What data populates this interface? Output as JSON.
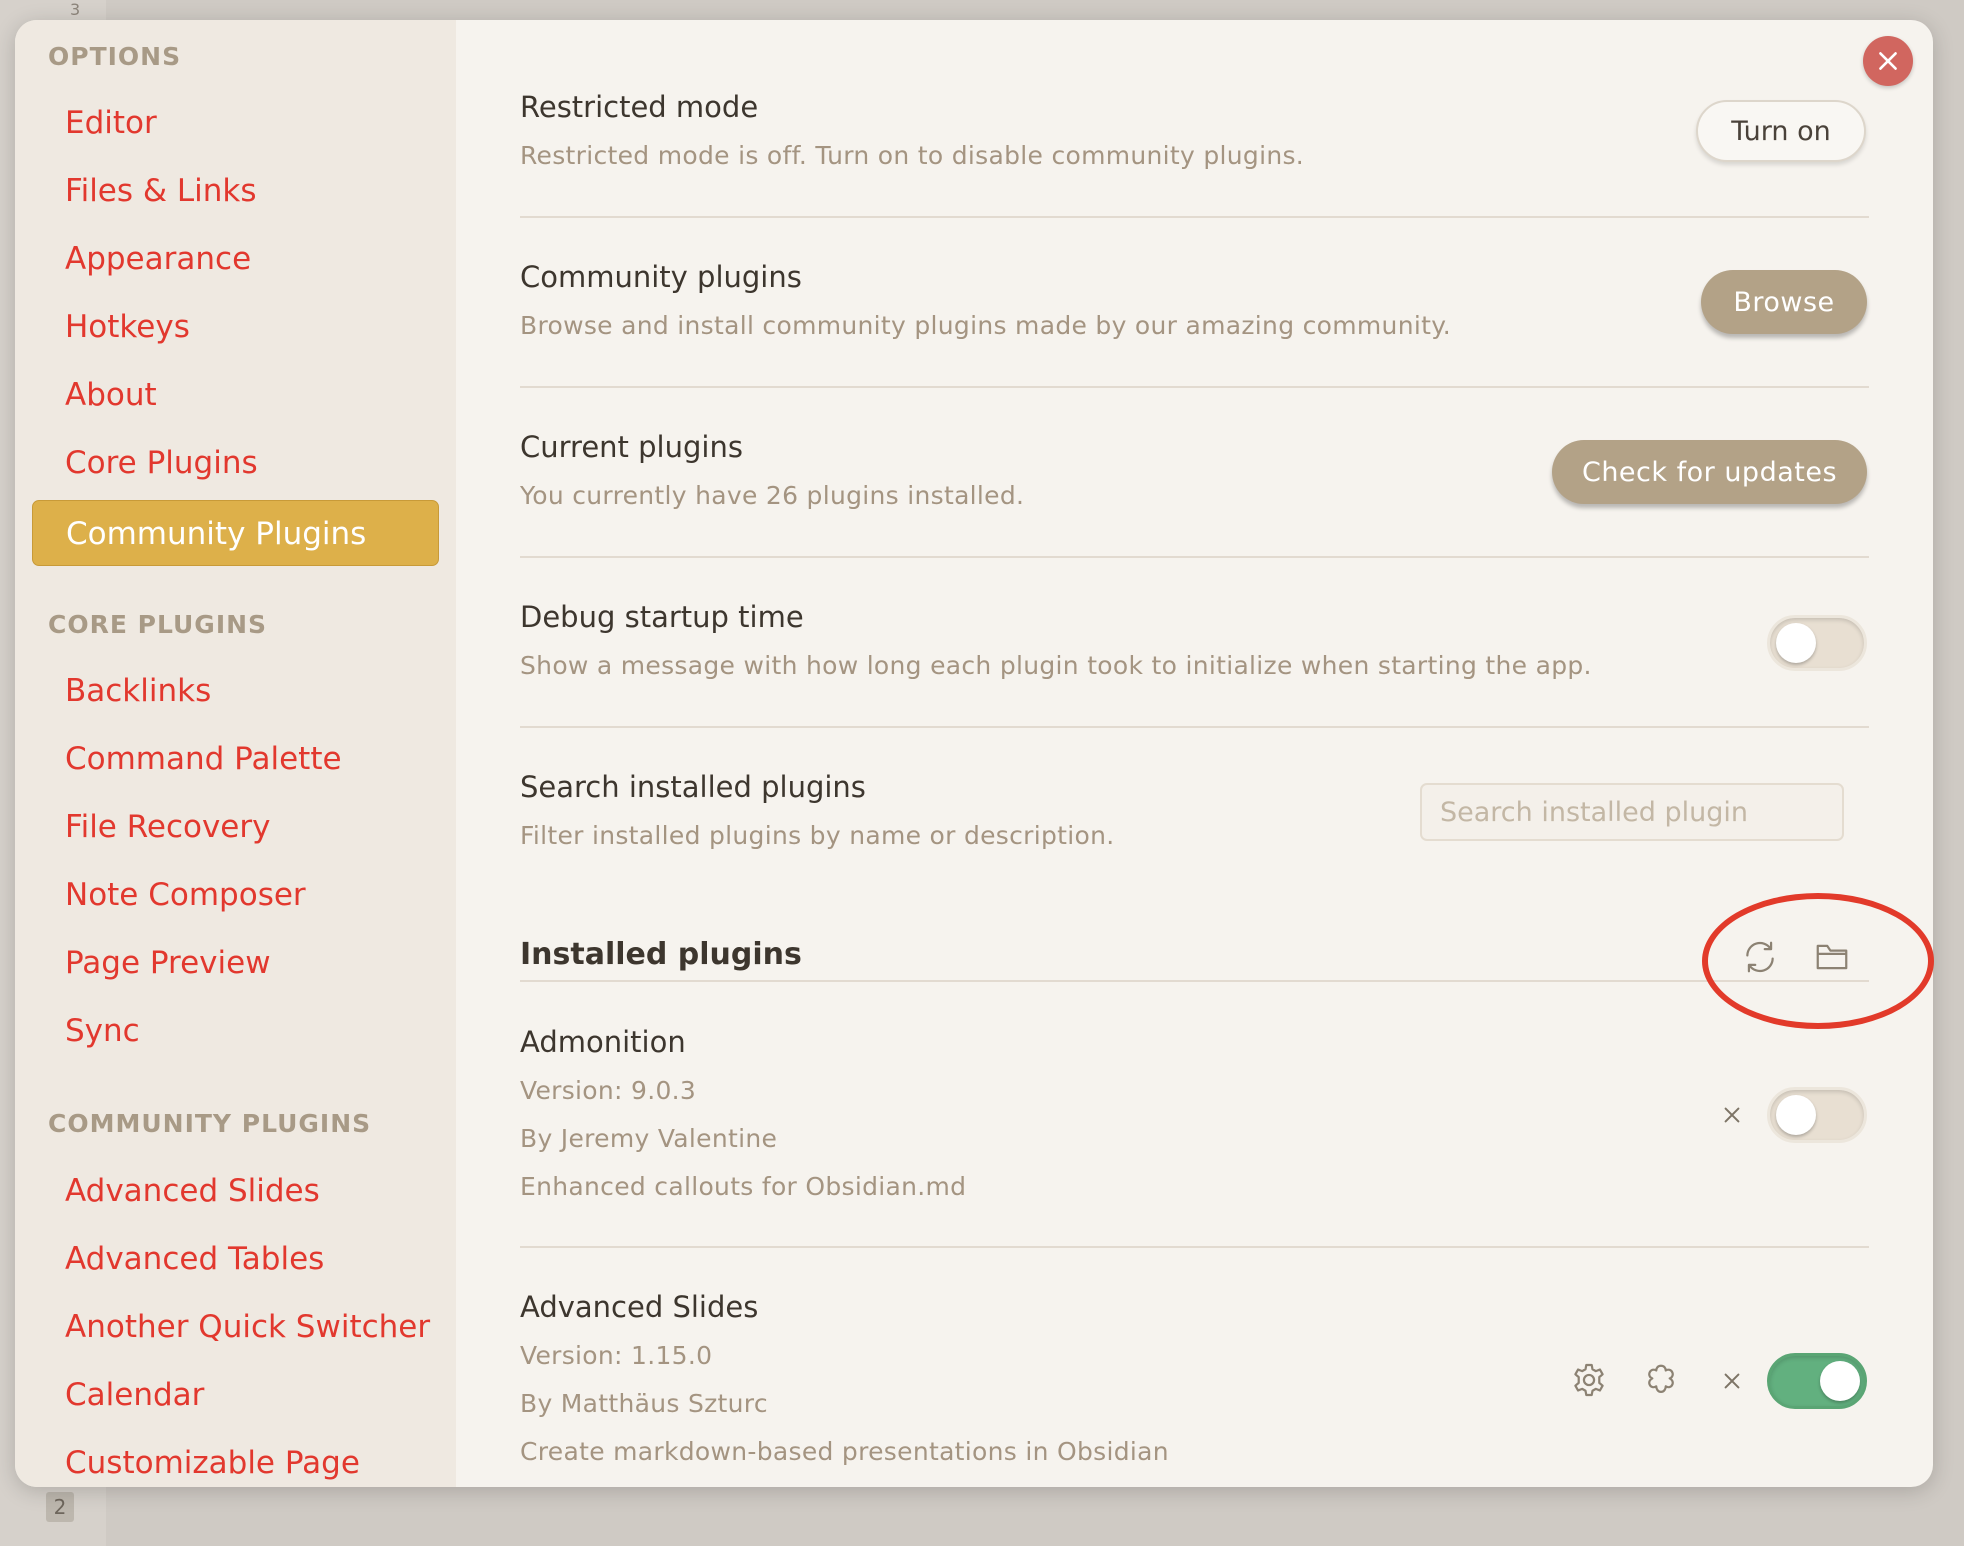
{
  "backdrop": {
    "page_number_top": "3",
    "page_number_bottom": "2"
  },
  "sidebar": {
    "options_heading": "OPTIONS",
    "options_items": [
      "Editor",
      "Files & Links",
      "Appearance",
      "Hotkeys",
      "About",
      "Core Plugins",
      "Community Plugins"
    ],
    "active_item": "Community Plugins",
    "core_heading": "CORE PLUGINS",
    "core_items": [
      "Backlinks",
      "Command Palette",
      "File Recovery",
      "Note Composer",
      "Page Preview",
      "Sync"
    ],
    "community_heading": "COMMUNITY PLUGINS",
    "community_items": [
      "Advanced Slides",
      "Advanced Tables",
      "Another Quick Switcher",
      "Calendar",
      "Customizable Page"
    ]
  },
  "settings": {
    "restricted": {
      "name": "Restricted mode",
      "desc": "Restricted mode is off. Turn on to disable community plugins.",
      "button": "Turn on"
    },
    "community": {
      "name": "Community plugins",
      "desc": "Browse and install community plugins made by our amazing community.",
      "button": "Browse"
    },
    "current": {
      "name": "Current plugins",
      "desc": "You currently have 26 plugins installed.",
      "button": "Check for updates"
    },
    "debug": {
      "name": "Debug startup time",
      "desc": "Show a message with how long each plugin took to initialize when starting the app.",
      "enabled": false
    },
    "search": {
      "name": "Search installed plugins",
      "desc": "Filter installed plugins by name or description.",
      "placeholder": "Search installed plugin",
      "value": ""
    }
  },
  "installed": {
    "title": "Installed plugins",
    "icons": [
      "reload-icon",
      "folder-icon"
    ],
    "plugins": [
      {
        "name": "Admonition",
        "version": "Version: 9.0.3",
        "author": "By Jeremy Valentine",
        "description": "Enhanced callouts for Obsidian.md",
        "enabled": false
      },
      {
        "name": "Advanced Slides",
        "version": "Version: 1.15.0",
        "author": "By Matthäus Szturc",
        "description": "Create markdown-based presentations in Obsidian",
        "enabled": true
      }
    ]
  },
  "colors": {
    "accent_link": "#e2382e",
    "active_bg": "#ddb04a",
    "toggle_on": "#62b07f",
    "annotation": "#e23a2a"
  }
}
